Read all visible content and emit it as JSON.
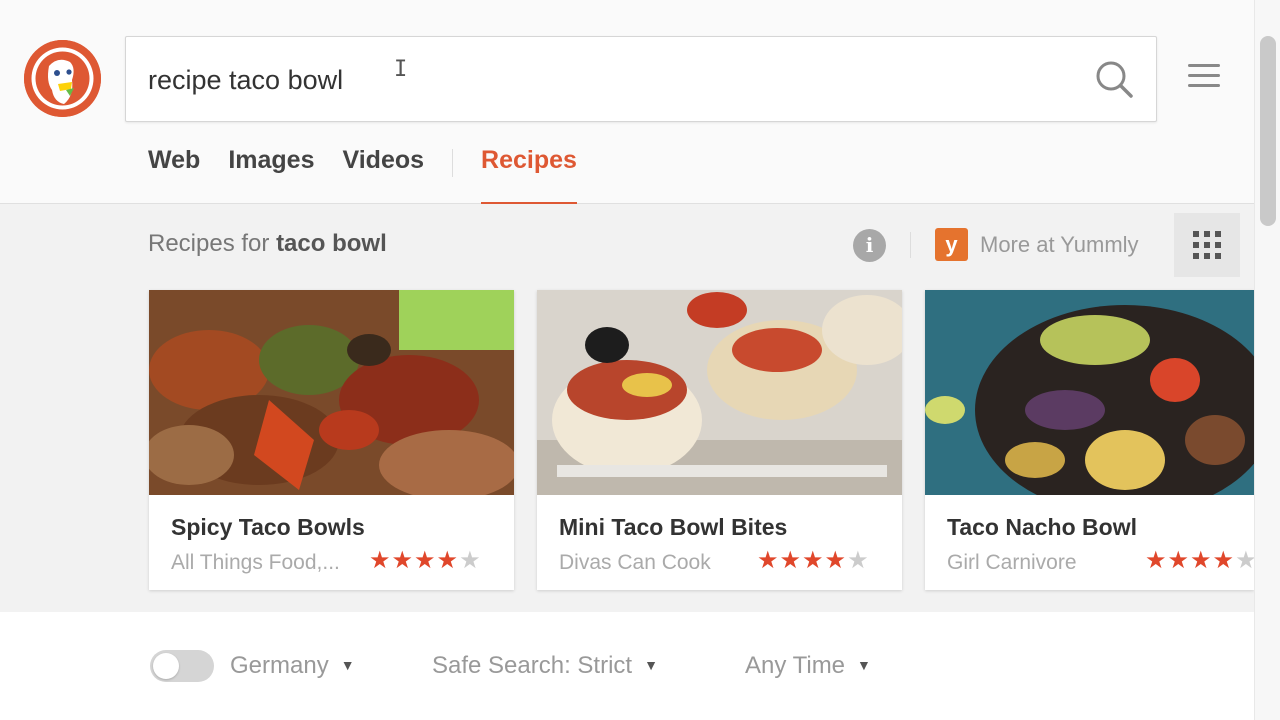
{
  "search": {
    "query": "recipe taco bowl",
    "cursor_glyph": "I"
  },
  "tabs": [
    {
      "label": "Web",
      "active": false
    },
    {
      "label": "Images",
      "active": false
    },
    {
      "label": "Videos",
      "active": false
    },
    {
      "label": "Recipes",
      "active": true
    }
  ],
  "results": {
    "prefix": "Recipes for",
    "query": "taco bowl",
    "info_glyph": "i",
    "provider_logo_letter": "y",
    "more_link": "More at Yummly"
  },
  "recipes": [
    {
      "title": "Spicy Taco Bowls",
      "source": "All Things Food,...",
      "rating": 4,
      "max_rating": 5
    },
    {
      "title": "Mini Taco Bowl Bites",
      "source": "Divas Can Cook",
      "rating": 4,
      "max_rating": 5
    },
    {
      "title": "Taco Nacho Bowl",
      "source": "Girl Carnivore",
      "rating": 4,
      "max_rating": 5
    }
  ],
  "footer": {
    "region": "Germany",
    "safe_search": "Safe Search: Strict",
    "time": "Any Time"
  },
  "colors": {
    "accent": "#de5833",
    "star": "#e0472b",
    "yummly": "#e5732e"
  },
  "icons": [
    "duckduckgo-logo",
    "search-icon",
    "hamburger-menu-icon",
    "info-icon",
    "yummly-logo",
    "grid-view-icon",
    "star-icon",
    "caret-down-icon"
  ]
}
